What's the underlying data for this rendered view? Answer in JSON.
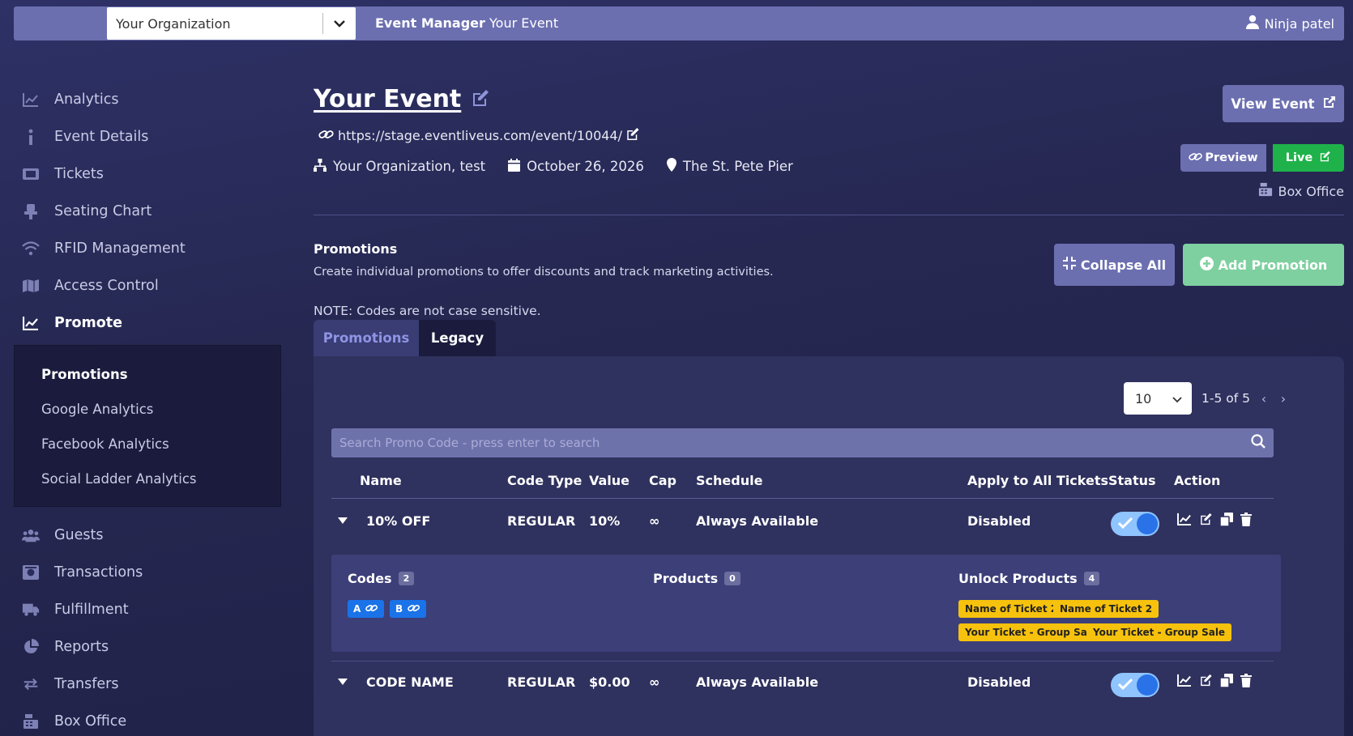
{
  "topbar": {
    "org_select": "Your Organization",
    "title_bold": "Event Manager",
    "title_rest": "Your Event",
    "user": "Ninja patel"
  },
  "sidebar": {
    "items": [
      {
        "label": "Analytics",
        "icon": "line-chart-icon"
      },
      {
        "label": "Event Details",
        "icon": "info-icon"
      },
      {
        "label": "Tickets",
        "icon": "ticket-icon"
      },
      {
        "label": "Seating Chart",
        "icon": "chair-icon"
      },
      {
        "label": "RFID Management",
        "icon": "wifi-icon"
      },
      {
        "label": "Access Control",
        "icon": "map-icon"
      },
      {
        "label": "Promote",
        "icon": "chart-icon"
      }
    ],
    "sub_items": [
      "Promotions",
      "Google Analytics",
      "Facebook Analytics",
      "Social Ladder Analytics"
    ],
    "items_bottom": [
      {
        "label": "Guests",
        "icon": "users-icon"
      },
      {
        "label": "Transactions",
        "icon": "register-icon"
      },
      {
        "label": "Fulfillment",
        "icon": "truck-icon"
      },
      {
        "label": "Reports",
        "icon": "pie-icon"
      },
      {
        "label": "Transfers",
        "icon": "transfer-icon"
      },
      {
        "label": "Box Office",
        "icon": "cash-register-icon"
      }
    ]
  },
  "event": {
    "title": "Your Event",
    "url": "https://stage.eventliveus.com/event/10044/",
    "org": "Your Organization, test",
    "date": "October 26, 2026",
    "venue": "The St. Pete Pier",
    "view_button": "View Event",
    "preview_button": "Preview",
    "live_button": "Live",
    "box_office": "Box Office"
  },
  "promotions": {
    "title": "Promotions",
    "description": "Create individual promotions to offer discounts and track marketing activities.",
    "note": "NOTE: Codes are not case sensitive.",
    "collapse_button": "Collapse All",
    "add_button": "Add Promotion",
    "tabs": [
      "Promotions",
      "Legacy"
    ],
    "per_page": "10",
    "range": "1-5 of 5",
    "search_placeholder": "Search Promo Code - press enter to search",
    "columns": [
      "Name",
      "Code Type",
      "Value",
      "Cap",
      "Schedule",
      "Apply to All Tickets",
      "Status",
      "Action"
    ],
    "rows": [
      {
        "name": "10% OFF",
        "code_type": "REGULAR",
        "value": "10%",
        "cap": "∞",
        "schedule": "Always Available",
        "apply_all": "Disabled",
        "status_on": true
      },
      {
        "name": "CODE NAME",
        "code_type": "REGULAR",
        "value": "$0.00",
        "cap": "∞",
        "schedule": "Always Available",
        "apply_all": "Disabled",
        "status_on": true
      }
    ],
    "detail": {
      "codes_label": "Codes",
      "codes_count": "2",
      "codes": [
        "A",
        "B"
      ],
      "products_label": "Products",
      "products_count": "0",
      "unlock_label": "Unlock Products",
      "unlock_count": "4",
      "unlock_items": [
        "Name of Ticket 2",
        "Name of Ticket 2",
        "Your Ticket - Group Sale",
        "Your Ticket - Group Sale"
      ]
    }
  },
  "colors": {
    "bar": "#6b6fb0",
    "live": "#1fb24a",
    "add": "#7ed0a0",
    "chip_blue": "#1a73e8",
    "chip_yellow": "#f7c20d"
  }
}
